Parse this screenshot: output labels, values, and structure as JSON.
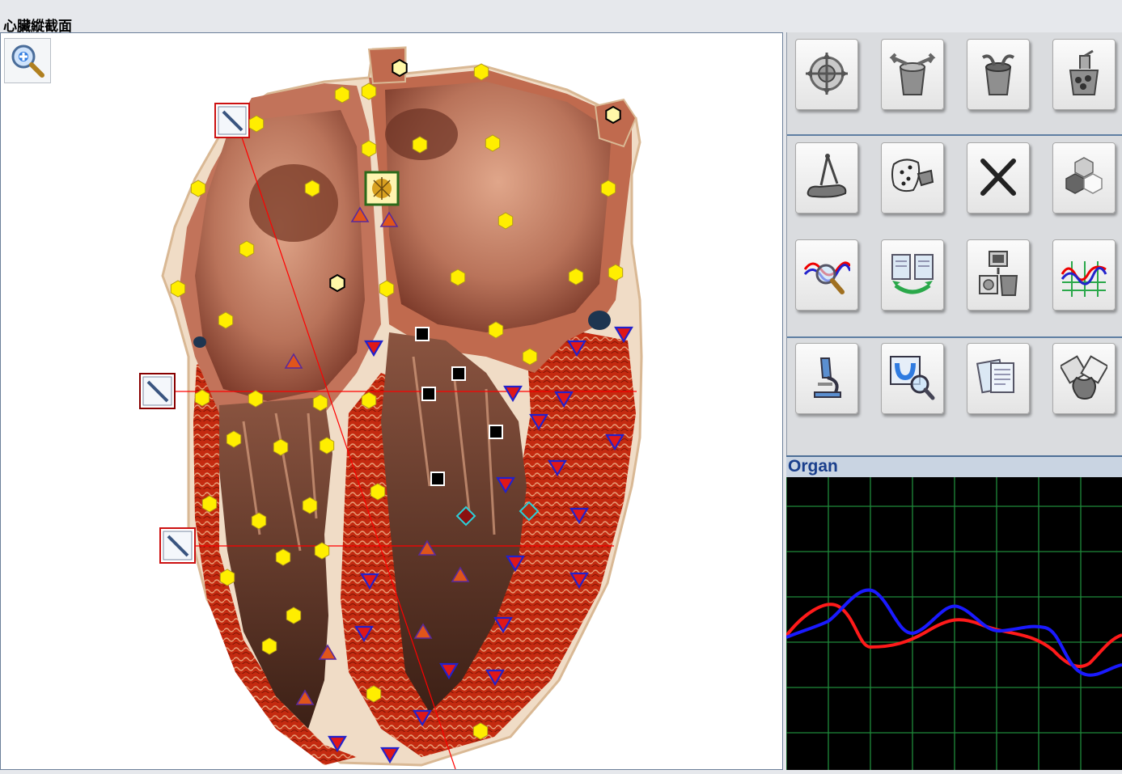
{
  "window": {
    "title": "心臟縱截面"
  },
  "zoom_tool": {
    "icon": "zoom-in-icon"
  },
  "toolbar": {
    "rows": [
      [
        {
          "icon": "target-crosshair-icon"
        },
        {
          "icon": "vessel-split-arrows-icon"
        },
        {
          "icon": "vessel-drain-icon"
        },
        {
          "icon": "vessel-cells-icon"
        }
      ],
      [
        {
          "icon": "foot-measure-compass-icon"
        },
        {
          "icon": "region-point-hand-icon"
        },
        {
          "icon": "cross-close-icon"
        },
        {
          "icon": "hexagon-cluster-icon"
        }
      ],
      [
        {
          "icon": "wave-magnifier-icon"
        },
        {
          "icon": "clipboard-exchange-icon"
        },
        {
          "icon": "device-transfer-icon"
        },
        {
          "icon": "multi-wave-chart-icon"
        }
      ],
      [
        {
          "icon": "microscope-icon"
        },
        {
          "icon": "scan-magnifier-icon"
        },
        {
          "icon": "documents-icon"
        },
        {
          "icon": "heart-organ-view-icon"
        }
      ]
    ]
  },
  "organ_panel": {
    "label": "Organ"
  },
  "colors": {
    "accent_blue": "#1a3f8c",
    "graph_grid": "#1f8a3a",
    "series_red": "#ff1a1a",
    "series_blue": "#1a1aff",
    "marker_yellow": "#ffee00",
    "marker_triangle_blue": "#2222cc",
    "marker_triangle_orange": "#e0551a"
  }
}
